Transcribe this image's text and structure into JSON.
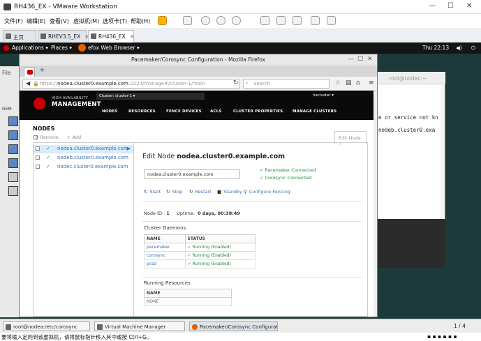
{
  "vmware": {
    "title": "RH436_EX - VMware Workstation",
    "menu": [
      "文件(F)",
      "编辑(E)",
      "查看(V)",
      "虚拟机(M)",
      "选项卡(T)",
      "帮助(H)"
    ],
    "tabs": [
      {
        "label": "主页"
      },
      {
        "label": "RHEV3.5_EX"
      },
      {
        "label": "RH436_EX"
      }
    ],
    "status_text": "要将输入定向到该虚拟机，请将鼠标指针移入其中或按 Ctrl+G。"
  },
  "gnome": {
    "applications": "Applications ▾",
    "places": "Places ▾",
    "active_app": "efox Web Browser ▾",
    "clock": "Thu 22:13"
  },
  "bg_terminal": {
    "title": "root@nodec:~",
    "lines": [
      "e or service not kn",
      "nodeb.cluster0.exa"
    ]
  },
  "left_window": {
    "label": "File",
    "item": "GEM"
  },
  "firefox": {
    "title": "Pacemaker/Corosync Configuration - Mozilla Firefox",
    "url_prefix": "https://",
    "url_host": "nodea.cluster0.example.com",
    "url_rest": ":2224/manage#/cluster-1/main",
    "search_placeholder": "Search"
  },
  "pcs": {
    "brand_small": "HIGH AVAILABILITY",
    "brand_big": "MANAGEMENT",
    "cluster_select": "Cluster: cluster-1 ▾",
    "user": "hacluster ▾",
    "nav": [
      "NODES",
      "RESOURCES",
      "FENCE DEVICES",
      "ACLS",
      "CLUSTER PROPERTIES",
      "MANAGE CLUSTERS"
    ],
    "section_title": "NODES",
    "remove_label": "Remove",
    "add_label": "Add",
    "edit_tab": "Edit Node",
    "nodes": [
      "nodea.cluster0.example.com",
      "nodeb.cluster0.example.com",
      "nodec.cluster0.example.com"
    ],
    "edit_title_prefix": "Edit Node",
    "edit_title_node": "nodea.cluster0.example.com",
    "node_input": "nodea.cluster0.example.com",
    "status": [
      "Pacemaker Connected",
      "Corosync Connected"
    ],
    "actions": [
      "Start",
      "Stop",
      "Restart",
      "Standby",
      "Configure Fencing"
    ],
    "node_id_label": "Node ID:",
    "node_id": "1",
    "uptime_label": "Uptime:",
    "uptime": "0 days, 00:38:49",
    "daemons_title": "Cluster Daemons",
    "daemons_headers": [
      "NAME",
      "STATUS"
    ],
    "daemons": [
      {
        "name": "pacemaker",
        "status": "Running (Enabled)"
      },
      {
        "name": "corosync",
        "status": "Running (Enabled)"
      },
      {
        "name": "pcsd",
        "status": "Running (Enabled)"
      }
    ],
    "resources_title": "Running Resources",
    "resources_header": "NAME",
    "resources_none": "NONE"
  },
  "taskbar": {
    "items": [
      "root@nodea:/etc/corosync",
      "Virtual Machine Manager",
      "Pacemaker/Corosync Configuratio..."
    ],
    "pager": "1 / 4"
  }
}
